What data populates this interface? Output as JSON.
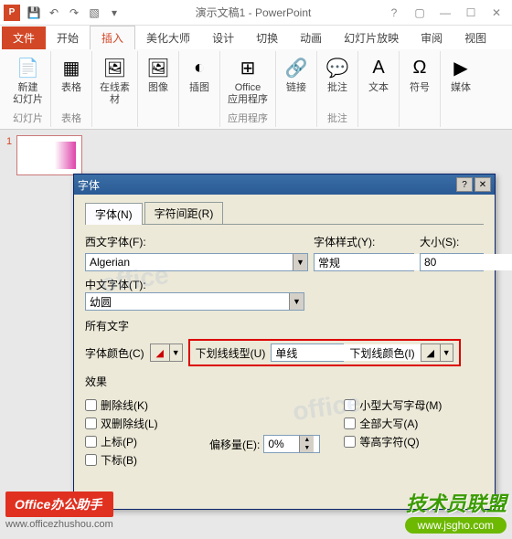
{
  "title": "演示文稿1 - PowerPoint",
  "menu": {
    "file": "文件",
    "home": "开始",
    "insert": "插入",
    "beautify": "美化大师",
    "design": "设计",
    "transition": "切换",
    "anim": "动画",
    "slideshow": "幻灯片放映",
    "review": "审阅",
    "view": "视图"
  },
  "ribbon": {
    "newslide": "新建\n幻灯片",
    "table": "表格",
    "online": "在线素\n材",
    "image": "图像",
    "illus": "插图",
    "office": "Office\n应用程序",
    "link": "链接",
    "comment": "批注",
    "text": "文本",
    "symbol": "符号",
    "media": "媒体",
    "g_slide": "幻灯片",
    "g_table": "表格",
    "g_apps": "应用程序",
    "g_comment": "批注"
  },
  "thumb_num": "1",
  "dialog": {
    "title": "字体",
    "tab_font": "字体(N)",
    "tab_spacing": "字符间距(R)",
    "western_label": "西文字体(F):",
    "western_value": "Algerian",
    "style_label": "字体样式(Y):",
    "style_value": "常规",
    "size_label": "大小(S):",
    "size_value": "80",
    "chinese_label": "中文字体(T):",
    "chinese_value": "幼圆",
    "allfonts": "所有文字",
    "fontcolor": "字体颜色(C)",
    "underline_type": "下划线线型(U)",
    "underline_value": "单线",
    "underline_color": "下划线颜色(I)",
    "effects": "效果",
    "strike": "删除线(K)",
    "dstrike": "双删除线(L)",
    "super": "上标(P)",
    "sub": "下标(B)",
    "offset_label": "偏移量(E):",
    "offset_value": "0%",
    "smallcaps": "小型大写字母(M)",
    "allcaps": "全部大写(A)",
    "equalh": "等高字符(Q)"
  },
  "footer": {
    "badge": "Office办公助手",
    "url": "www.officezhushou.com",
    "brand": "技术员联盟",
    "brandurl": "www.jsgho.com"
  }
}
